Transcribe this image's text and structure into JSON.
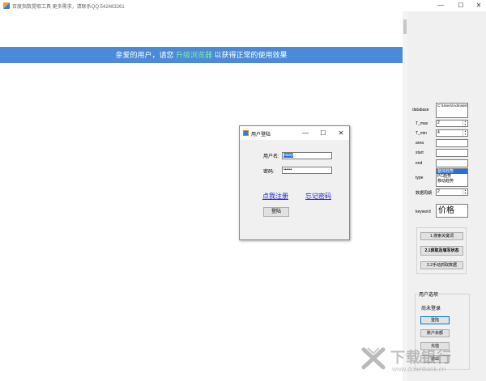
{
  "window": {
    "title": "百度指数提取工具  更多需求，请联系QQ:542483261"
  },
  "banner": {
    "prefix": "亲爱的用户，请您 ",
    "highlight": "升级浏览器",
    "suffix": " 以获得正常的使用效果"
  },
  "login_dialog": {
    "title": "用户登陆",
    "username_label": "用户名:",
    "username_value": "bianji",
    "password_label": "密码:",
    "password_value": "••••••",
    "register_link": "点我注册",
    "forgot_link": "忘记密码",
    "login_button": "登陆"
  },
  "panel": {
    "database_label": "database",
    "database_value": "C:\\Users\\Administrator\\AppData",
    "tmax_label": "T_max",
    "tmax_value": "2",
    "tmin_label": "T_min",
    "tmin_value": "4",
    "area_label": "area",
    "start_label": "start",
    "end_label": "end",
    "type_label": "type",
    "type_options": [
      "整体趋势",
      "PC趋势",
      "移动趋势"
    ],
    "period_label": "数据周期",
    "period_value": "2",
    "keyword_label": "keyword",
    "keyword_value": "价格",
    "btn_search_keyword": "1.搜索关键词",
    "btn_fetch": "2.1获取及填写状态",
    "btn_manual": "2.2手动抓取数据",
    "user_group_title": "用户选项",
    "user_status": "尚未登录",
    "btn_login": "登陆",
    "btn_balance": "账户余额",
    "btn_recharge": "充值",
    "btn_logout": "退出"
  },
  "watermark": {
    "text": "下载银行",
    "url": "www.downbank.cn"
  }
}
